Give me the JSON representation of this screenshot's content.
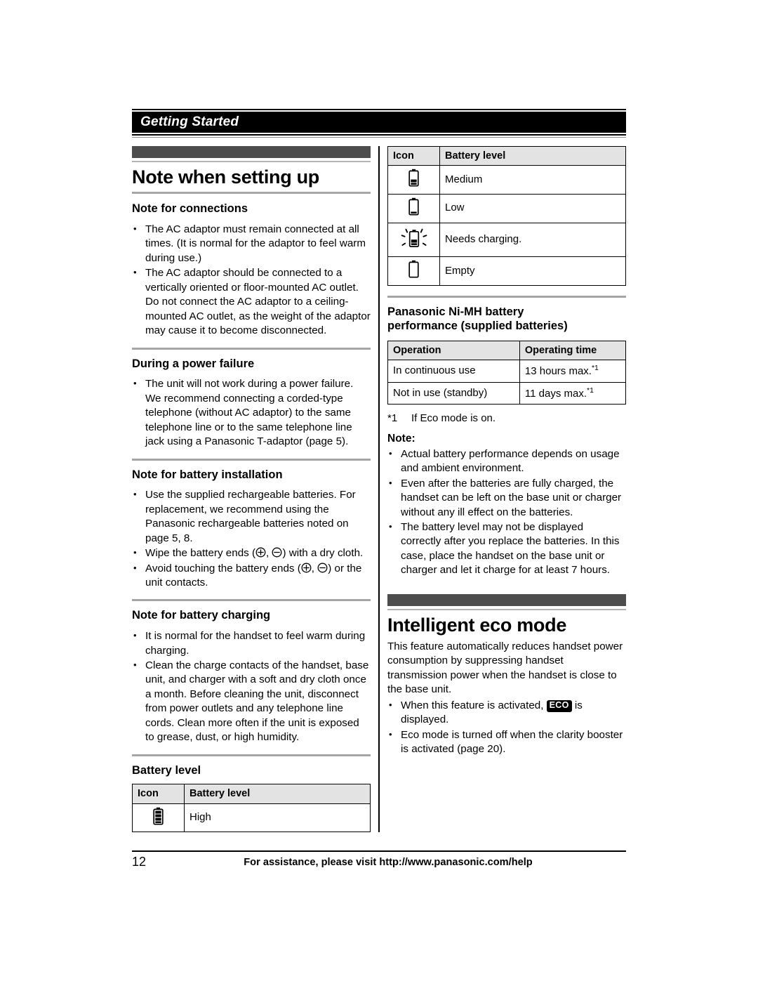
{
  "running_head": {
    "title": "Getting Started"
  },
  "chapter": {
    "title": "Note when setting up"
  },
  "left_column": {
    "sections": [
      {
        "heading": "Note for connections",
        "bullets": [
          "The AC adaptor must remain connected at all times. (It is normal for the adaptor to feel warm during use.)",
          "The AC adaptor should be connected to a vertically oriented or floor-mounted AC outlet. Do not connect the AC adaptor to a ceiling-mounted AC outlet, as the weight of the adaptor may cause it to become disconnected."
        ]
      },
      {
        "heading": "During a power failure",
        "bullets": [
          "The unit will not work during a power failure. We recommend connecting a corded-type telephone (without AC adaptor) to the same telephone line or to the same telephone line jack using a Panasonic T-adaptor (page 5)."
        ]
      },
      {
        "heading": "Note for battery installation",
        "bullets": [
          "Use the supplied rechargeable batteries. For replacement, we recommend using the Panasonic rechargeable batteries noted on page 5, 8.",
          "Wipe the battery ends (⊕, ⊖) with a dry cloth.",
          "Avoid touching the battery ends (⊕, ⊖) or the unit contacts."
        ],
        "bullet_parts": {
          "wipe_pre": "Wipe the battery ends (",
          "wipe_mid": ", ",
          "wipe_post": ") with a dry cloth.",
          "avoid_pre": "Avoid touching the battery ends (",
          "avoid_mid": ", ",
          "avoid_post": ") or the unit contacts."
        }
      },
      {
        "heading": "Note for battery charging",
        "bullets": [
          "It is normal for the handset to feel warm during charging.",
          "Clean the charge contacts of the handset, base unit, and charger with a soft and dry cloth once a month. Before cleaning the unit, disconnect from power outlets and any telephone line cords. Clean more often if the unit is exposed to grease, dust, or high humidity."
        ]
      },
      {
        "heading": "Battery level"
      }
    ],
    "battery_level_table": {
      "columns": [
        "Icon",
        "Battery level"
      ],
      "rows": [
        {
          "icon": "battery-high-icon",
          "level": "High"
        }
      ]
    }
  },
  "right_column": {
    "battery_level_table": {
      "columns": [
        "Icon",
        "Battery level"
      ],
      "rows": [
        {
          "icon": "battery-medium-icon",
          "level": "Medium"
        },
        {
          "icon": "battery-low-icon",
          "level": "Low"
        },
        {
          "icon": "battery-needs-charging-icon",
          "level": "Needs charging."
        },
        {
          "icon": "battery-empty-icon",
          "level": "Empty"
        }
      ]
    },
    "performance_section": {
      "heading_line1": "Panasonic Ni-MH battery",
      "heading_line2": "performance (supplied batteries)",
      "table": {
        "columns": [
          "Operation",
          "Operating time"
        ],
        "rows": [
          {
            "operation": "In continuous use",
            "time": "13 hours max.",
            "footnote": "*1"
          },
          {
            "operation": "Not in use (standby)",
            "time": "11 days max.",
            "footnote": "*1"
          }
        ]
      },
      "footnote_mark": "*1",
      "footnote_text": "If Eco mode is on.",
      "note_label": "Note:",
      "note_bullets": [
        "Actual battery performance depends on usage and ambient environment.",
        "Even after the batteries are fully charged, the handset can be left on the base unit or charger without any ill effect on the batteries.",
        "The battery level may not be displayed correctly after you replace the batteries. In this case, place the handset on the base unit or charger and let it charge for at least 7 hours."
      ]
    },
    "eco_section": {
      "title": "Intelligent eco mode",
      "intro": "This feature automatically reduces handset power consumption by suppressing handset transmission power when the handset is close to the base unit.",
      "bullets": [
        {
          "pre": "When this feature is activated, ",
          "badge": "ECO",
          "post": " is displayed."
        },
        {
          "pre": "Eco mode is turned off when the clarity booster is activated (page 20)."
        }
      ]
    }
  },
  "footer": {
    "page_number": "12",
    "assistance_text": "For assistance, please visit http://www.panasonic.com/help"
  },
  "colors": {
    "chapter_bar": "#4d4d4d",
    "divider": "#a6a6a6",
    "table_header_bg": "#e3e3e3",
    "running_head_bg": "#000000"
  }
}
